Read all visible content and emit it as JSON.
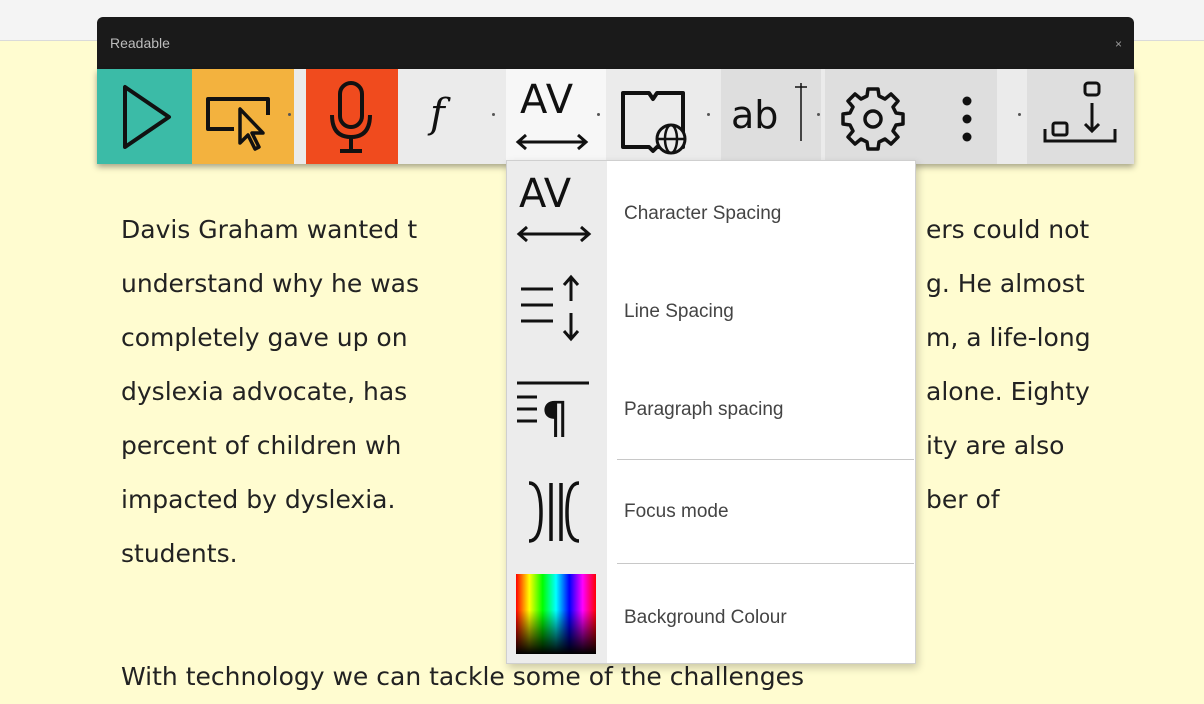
{
  "app": {
    "title": "Readable",
    "close_glyph": "×"
  },
  "toolbar": {
    "buttons": [
      {
        "id": "play",
        "icon": "play-icon",
        "color": "#3bbba7"
      },
      {
        "id": "select",
        "icon": "screen-select-icon",
        "color": "#f3b23e"
      },
      {
        "id": "mic",
        "icon": "microphone-icon",
        "color": "#f04b1e"
      },
      {
        "id": "font",
        "icon": "font-icon",
        "glyph": "f"
      },
      {
        "id": "spacing",
        "icon": "character-spacing-icon",
        "glyph": "AV"
      },
      {
        "id": "dictionary",
        "icon": "dictionary-icon"
      },
      {
        "id": "text-size",
        "icon": "text-size-icon",
        "glyph": "ab"
      },
      {
        "id": "settings",
        "icon": "gear-icon"
      },
      {
        "id": "more",
        "icon": "more-vertical-icon"
      },
      {
        "id": "download",
        "icon": "download-icon"
      }
    ]
  },
  "dropdown": {
    "items": [
      {
        "label": "Character Spacing",
        "icon": "character-spacing-icon",
        "glyph": "AV"
      },
      {
        "label": "Line Spacing",
        "icon": "line-spacing-icon"
      },
      {
        "label": "Paragraph spacing",
        "icon": "paragraph-spacing-icon"
      },
      {
        "label": "Focus mode",
        "icon": "focus-mode-icon"
      },
      {
        "label": "Background Colour",
        "icon": "color-swatch-icon"
      }
    ]
  },
  "content": {
    "paragraph_lines": [
      "Davis Graham wanted t",
      "understand why he was",
      "completely gave up on",
      "dyslexia advocate, has",
      "percent of children wh",
      "impacted by dyslexia.",
      "students."
    ],
    "right_fragments": [
      "ers could not",
      "g. He almost",
      "m, a life-long",
      "alone. Eighty",
      "ity are also",
      "ber of"
    ],
    "next_line": "With technology we can tackle some of the challenges"
  },
  "colors": {
    "page_background": "#fffcd0",
    "titlebar": "#1a1a1a",
    "toolbar": "#ebebeb"
  }
}
